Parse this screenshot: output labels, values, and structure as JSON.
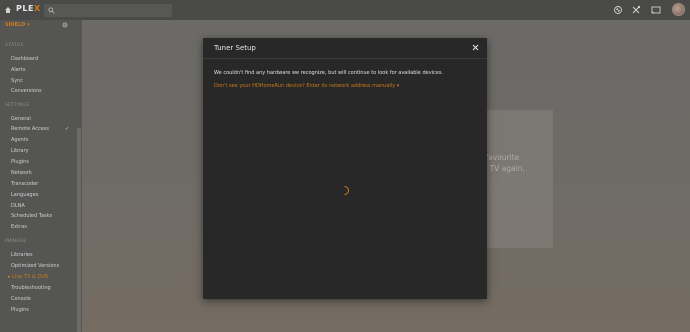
{
  "header": {
    "logo_text": "PLEX",
    "logo_accent": "X",
    "icons": [
      "home-icon",
      "search-icon",
      "activity-icon",
      "settings-tools-icon",
      "cast-icon"
    ],
    "accent_color": "#cc7b19"
  },
  "sidebar": {
    "server_name": "SHIELD ▾",
    "sections": {
      "status": "STATUS",
      "settings": "SETTINGS",
      "manage": "MANAGE"
    },
    "status_items": [
      "Dashboard",
      "Alerts",
      "Sync",
      "Conversions"
    ],
    "settings_items": [
      "General",
      "Remote Access",
      "Agents",
      "Library",
      "Plugins",
      "Network",
      "Transcoder",
      "Languages",
      "DLNA",
      "Scheduled Tasks",
      "Extras"
    ],
    "manage_items": [
      "Libraries",
      "Optimized Versions",
      "Live TV & DVR",
      "Troubleshooting",
      "Console",
      "Plugins"
    ],
    "active_item": "Live TV & DVR",
    "remote_access_check": "✓"
  },
  "background": {
    "line1": "ch your favourite",
    "line2": "and love TV again."
  },
  "modal": {
    "title": "Tuner Setup",
    "message": "We couldn't find any hardware we recognize, but will continue to look for available devices.",
    "link": "Don't see your HDHomeRun device? Enter its network address manually ▾"
  }
}
